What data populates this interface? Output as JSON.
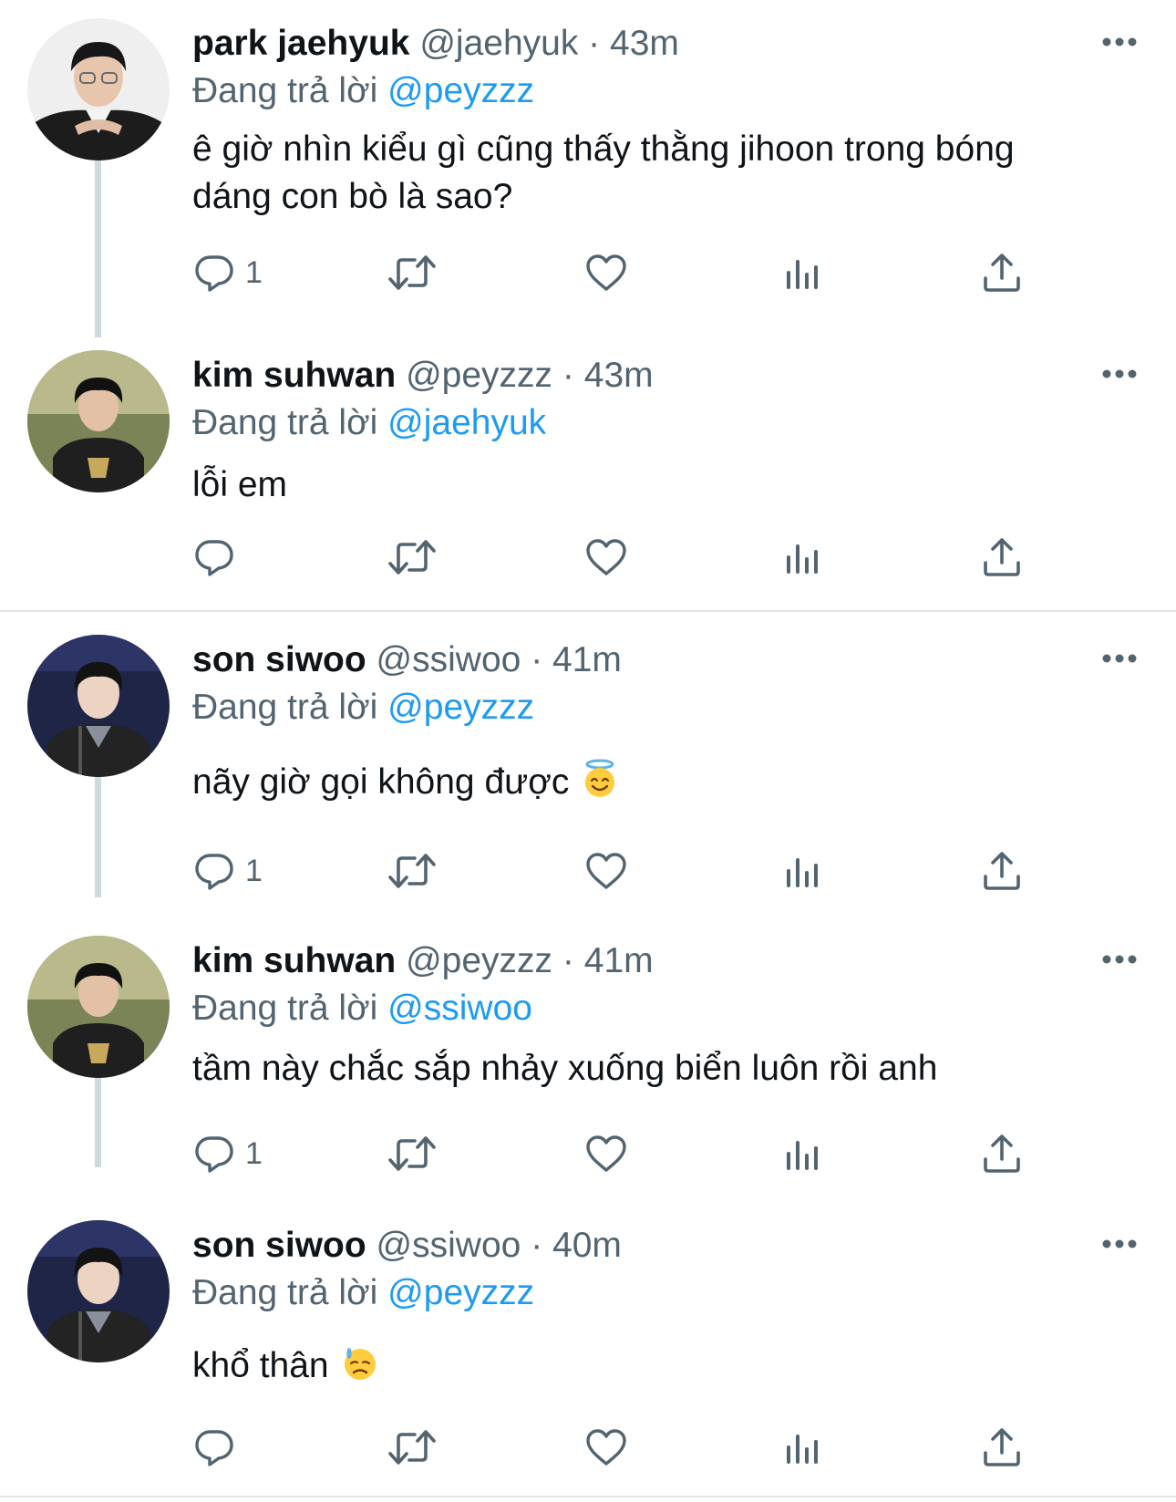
{
  "reply_prefix": "Đang trả lời",
  "tweets": [
    {
      "name": "park jaehyuk",
      "handle": "@jaehyuk",
      "time": "43m",
      "reply_to": "@peyzzz",
      "text_line1": "ê giờ nhìn kiểu gì cũng thấy thằng jihoon trong bóng",
      "text_line2": "dáng con bò là sao?",
      "reply_count": "1"
    },
    {
      "name": "kim suhwan",
      "handle": "@peyzzz",
      "time": "43m",
      "reply_to": "@jaehyuk",
      "text": "lỗi em",
      "reply_count": ""
    },
    {
      "name": "son siwoo",
      "handle": "@ssiwoo",
      "time": "41m",
      "reply_to": "@peyzzz",
      "text": "nãy giờ gọi không được",
      "emoji": "smiling-face-with-halo",
      "reply_count": "1"
    },
    {
      "name": "kim suhwan",
      "handle": "@peyzzz",
      "time": "41m",
      "reply_to": "@ssiwoo",
      "text": "tầm này chắc sắp nhảy xuống biển luôn rồi anh",
      "reply_count": "1"
    },
    {
      "name": "son siwoo",
      "handle": "@ssiwoo",
      "time": "40m",
      "reply_to": "@peyzzz",
      "text": "khổ thân",
      "emoji": "downcast-face-with-sweat",
      "reply_count": ""
    }
  ],
  "colors": {
    "link": "#1d9bf0",
    "secondary_text": "#536471",
    "thread_line": "#cfd9de"
  }
}
